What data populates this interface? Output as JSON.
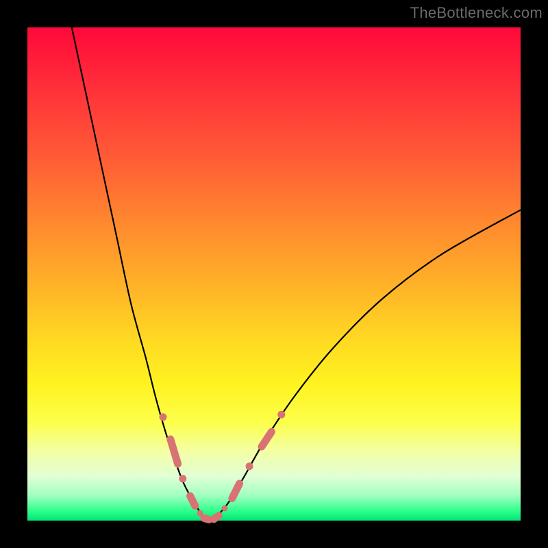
{
  "watermark": "TheBottleneck.com",
  "colors": {
    "frame": "#000000",
    "curve": "#000000",
    "marker": "#d97373",
    "gradient_stops": [
      "#ff083a",
      "#ff2f3a",
      "#ff5a36",
      "#ff8a2e",
      "#ffb128",
      "#ffd823",
      "#fff21f",
      "#fdff4a",
      "#f3ffa5",
      "#e2ffd5",
      "#9fffc0",
      "#2fff8c",
      "#00e675"
    ]
  },
  "chart_data": {
    "type": "line",
    "title": "",
    "xlabel": "",
    "ylabel": "",
    "xlim": [
      0,
      100
    ],
    "ylim": [
      0,
      100
    ],
    "grid": false,
    "legend": false,
    "series": [
      {
        "name": "left-branch",
        "comment": "Steep descending curve from top-left into the valley floor",
        "x": [
          9,
          12,
          15,
          18,
          21,
          24,
          26,
          28,
          30,
          31.5,
          33,
          34.5,
          35.5,
          36.5
        ],
        "y": [
          100,
          86,
          72,
          58,
          44,
          33,
          25,
          18,
          12,
          8,
          5,
          2.5,
          1,
          0
        ]
      },
      {
        "name": "right-branch",
        "comment": "Gentler ascending curve from valley floor toward upper-right",
        "x": [
          37.5,
          39,
          41,
          44,
          48,
          54,
          62,
          72,
          84,
          100
        ],
        "y": [
          0,
          1.5,
          4,
          9,
          16,
          25,
          35,
          45,
          54,
          63
        ]
      }
    ],
    "markers": {
      "comment": "Salmon bead/segment overlays near the valley; values approximate from plot",
      "left_side": [
        {
          "x": 27.5,
          "y": 21
        },
        {
          "x": 29.0,
          "y": 16.5
        },
        {
          "x": 30.5,
          "y": 11.5
        },
        {
          "x": 31.5,
          "y": 8.5
        },
        {
          "x": 33.0,
          "y": 5.0
        },
        {
          "x": 34.0,
          "y": 3.0
        },
        {
          "x": 35.0,
          "y": 1.5
        }
      ],
      "floor": [
        {
          "x": 35.8,
          "y": 0.5
        },
        {
          "x": 36.8,
          "y": 0.2
        },
        {
          "x": 37.8,
          "y": 0.3
        },
        {
          "x": 38.8,
          "y": 1.0
        }
      ],
      "right_side": [
        {
          "x": 40.0,
          "y": 2.5
        },
        {
          "x": 41.5,
          "y": 4.5
        },
        {
          "x": 43.0,
          "y": 7.5
        },
        {
          "x": 45.0,
          "y": 11.0
        },
        {
          "x": 47.5,
          "y": 15.0
        },
        {
          "x": 49.5,
          "y": 18.0
        },
        {
          "x": 51.5,
          "y": 21.5
        }
      ]
    }
  }
}
